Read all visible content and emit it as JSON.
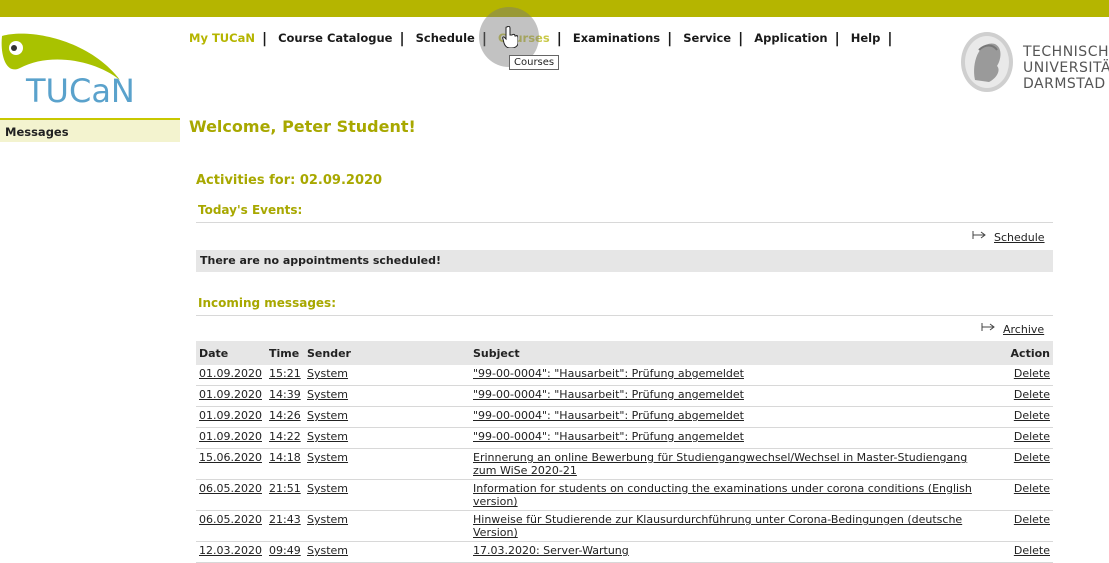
{
  "header": {
    "logo_text": "TUCaN",
    "nav": [
      {
        "label": "My TUCaN",
        "active": true
      },
      {
        "label": "Course Catalogue",
        "active": false
      },
      {
        "label": "Schedule",
        "active": false
      },
      {
        "label": "Courses",
        "active": false
      },
      {
        "label": "Examinations",
        "active": false
      },
      {
        "label": "Service",
        "active": false
      },
      {
        "label": "Application",
        "active": false
      },
      {
        "label": "Help",
        "active": false
      }
    ],
    "tooltip": "Courses",
    "university_lines": [
      "TECHNISCH",
      "UNIVERSITÄ",
      "DARMSTAD"
    ]
  },
  "sidebar": {
    "items": [
      {
        "label": "Messages"
      }
    ]
  },
  "main": {
    "welcome": "Welcome, Peter Student!",
    "activities_title": "Activities for: 02.09.2020",
    "todays_events_title": "Today's Events:",
    "schedule_link": "Schedule",
    "no_appointments": "There are no appointments scheduled!",
    "incoming_title": "Incoming messages:",
    "archive_link": "Archive",
    "columns": [
      "Date",
      "Time",
      "Sender",
      "Subject",
      "Action"
    ],
    "messages": [
      {
        "date": "01.09.2020",
        "time": "15:21",
        "sender": "System",
        "subject": "\"99-00-0004\": \"Hausarbeit\": Prüfung abgemeldet",
        "action": "Delete"
      },
      {
        "date": "01.09.2020",
        "time": "14:39",
        "sender": "System",
        "subject": "\"99-00-0004\": \"Hausarbeit\": Prüfung angemeldet",
        "action": "Delete"
      },
      {
        "date": "01.09.2020",
        "time": "14:26",
        "sender": "System",
        "subject": "\"99-00-0004\": \"Hausarbeit\": Prüfung abgemeldet",
        "action": "Delete"
      },
      {
        "date": "01.09.2020",
        "time": "14:22",
        "sender": "System",
        "subject": "\"99-00-0004\": \"Hausarbeit\": Prüfung angemeldet",
        "action": "Delete"
      },
      {
        "date": "15.06.2020",
        "time": "14:18",
        "sender": "System",
        "subject": "Erinnerung an online Bewerbung für Studiengangwechsel/Wechsel in Master-Studiengang zum WiSe 2020-21",
        "action": "Delete"
      },
      {
        "date": "06.05.2020",
        "time": "21:51",
        "sender": "System",
        "subject": "Information for students on conducting the examinations under corona conditions (English version)",
        "action": "Delete"
      },
      {
        "date": "06.05.2020",
        "time": "21:43",
        "sender": "System",
        "subject": "Hinweise für Studierende zur Klausurdurchführung unter Corona-Bedingungen (deutsche Version)",
        "action": "Delete"
      },
      {
        "date": "12.03.2020",
        "time": "09:49",
        "sender": "System",
        "subject": "17.03.2020: Server-Wartung",
        "action": "Delete"
      }
    ]
  },
  "colors": {
    "accent": "#a8a800",
    "topbar": "#b5b500",
    "logo_blue": "#5aa2cc"
  }
}
